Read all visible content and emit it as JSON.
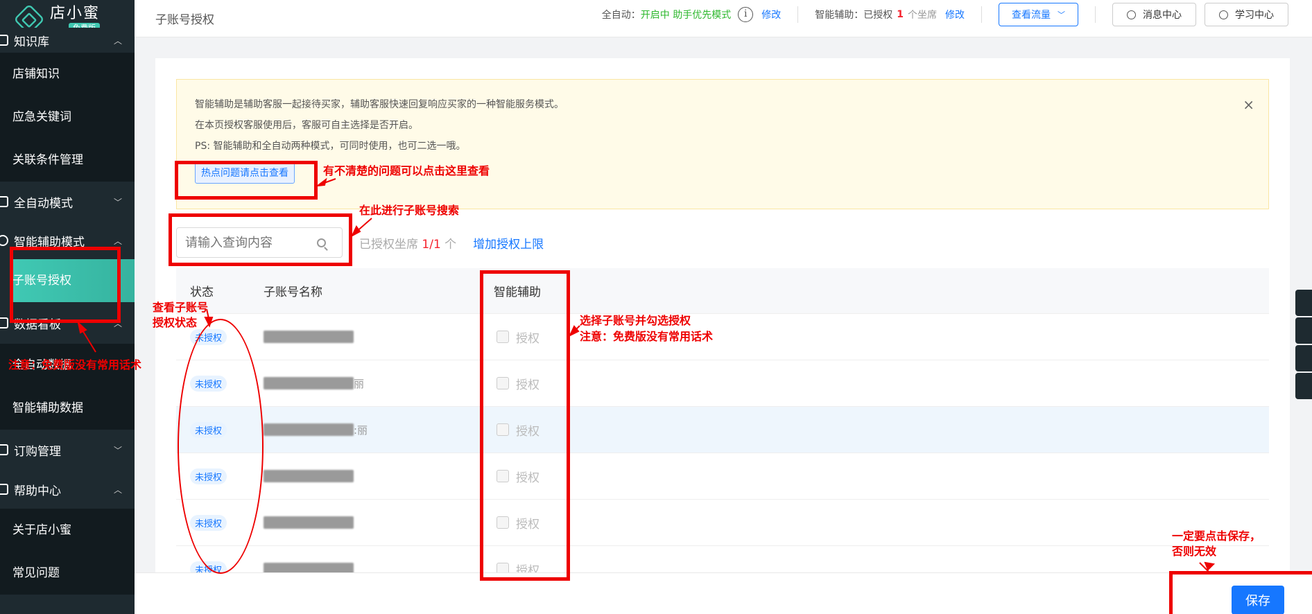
{
  "sidebar": {
    "logo_name": "店小蜜",
    "logo_badge": "免费版",
    "groups": [
      {
        "label": "知识库",
        "items": [
          "店铺知识",
          "应急关键词",
          "关联条件管理"
        ]
      },
      {
        "label": "全自动模式",
        "items": []
      },
      {
        "label": "智能辅助模式",
        "items": [
          "子账号授权"
        ]
      },
      {
        "label": "数据看板",
        "items": [
          "全自动数据",
          "智能辅助数据"
        ]
      },
      {
        "label": "订购管理",
        "items": []
      },
      {
        "label": "帮助中心",
        "items": [
          "关于店小蜜",
          "常见问题"
        ]
      }
    ]
  },
  "topbar": {
    "title": "子账号授权",
    "auto_label": "全自动：",
    "auto_status": "开启中 助手优先模式",
    "edit1": "修改",
    "assist_label": "智能辅助：已授权",
    "assist_count": "1",
    "assist_unit": "个坐席",
    "edit2": "修改",
    "view_traffic": "查看流量",
    "msg_center": "消息中心",
    "study_center": "学习中心"
  },
  "notice": {
    "line1": "智能辅助是辅助客服一起接待买家，辅助客服快速回复响应买家的一种智能服务模式。",
    "line2": "在本页授权客服使用后，客服可自主选择是否开启。",
    "line3": "PS: 智能辅助和全自动两种模式，可同时使用，也可二选一哦。",
    "hot_button": "热点问题请点击查看"
  },
  "search": {
    "placeholder": "请输入查询内容",
    "seat_prefix": "已授权坐席",
    "seat_count": "1/1",
    "seat_suffix": "个",
    "add_limit": "增加授权上限"
  },
  "table": {
    "headers": [
      "状态",
      "子账号名称",
      "智能辅助"
    ],
    "rows": [
      {
        "status": "未授权",
        "name_suffix": "",
        "auth": "授权"
      },
      {
        "status": "未授权",
        "name_suffix": "丽",
        "auth": "授权"
      },
      {
        "status": "未授权",
        "name_suffix": ":丽",
        "auth": "授权"
      },
      {
        "status": "未授权",
        "name_suffix": "",
        "auth": "授权"
      },
      {
        "status": "未授权",
        "name_suffix": "",
        "auth": "授权"
      },
      {
        "status": "未授权",
        "name_suffix": "",
        "auth": "授权"
      }
    ]
  },
  "footer": {
    "save": "保存"
  },
  "annotations": {
    "hot_hint": "有不清楚的问题可以点击这里查看",
    "search_hint": "在此进行子账号搜索",
    "status_hint_1": "查看子账号",
    "status_hint_2": "授权状态",
    "select_hint_1": "选择子账号并勾选授权",
    "select_hint_2": "注意：免费版没有常用话术",
    "sidebar_hint": "注意：免费版没有常用话术",
    "save_hint_1": "一定要点击保存，",
    "save_hint_2": "否则无效",
    "color": "#e00000"
  }
}
